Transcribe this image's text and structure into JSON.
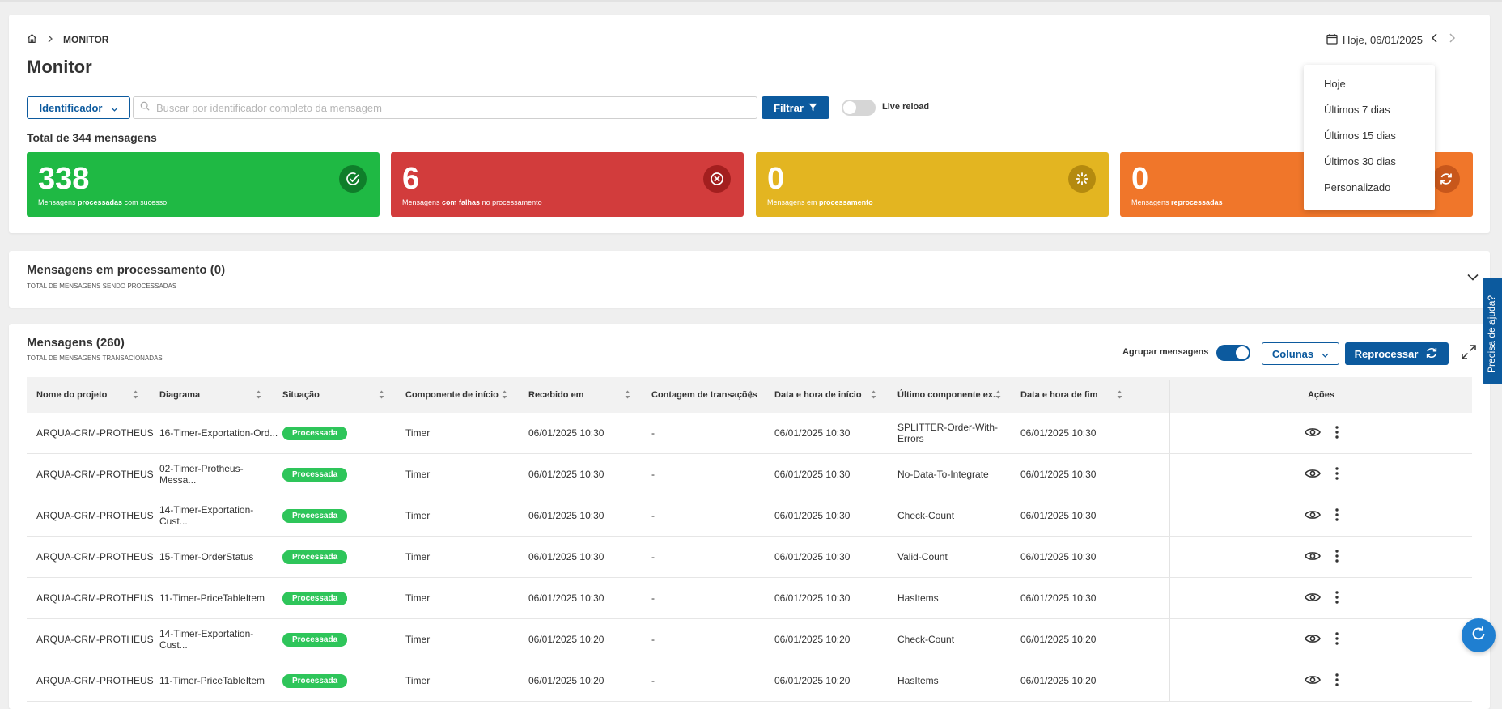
{
  "breadcrumb": {
    "current": "MONITOR"
  },
  "page_title": "Monitor",
  "search": {
    "select_label": "Identificador",
    "placeholder": "Buscar por identificador completo da mensagem",
    "value": ""
  },
  "filter_button": "Filtrar",
  "live_reload": {
    "label": "Live reload",
    "enabled": false
  },
  "date_nav": {
    "label": "Hoje, 06/01/2025"
  },
  "date_dropdown": [
    "Hoje",
    "Últimos 7 dias",
    "Últimos 15 dias",
    "Últimos 30 dias",
    "Personalizado"
  ],
  "total_label": "Total de 344 mensagens",
  "stats": [
    {
      "value": "338",
      "pre": "Mensagens ",
      "bold": "processadas",
      "post": " com sucesso",
      "color": "#1fb944",
      "icon": "check-circle-icon"
    },
    {
      "value": "6",
      "pre": "Mensagens ",
      "bold": "com falhas",
      "post": " no processamento",
      "color": "#d23c3c",
      "icon": "x-circle-icon"
    },
    {
      "value": "0",
      "pre": "Mensagens em ",
      "bold": "processamento",
      "post": "",
      "color": "#e3b521",
      "icon": "spinner-icon"
    },
    {
      "value": "0",
      "pre": "Mensagens ",
      "bold": "reprocessadas",
      "post": "",
      "color": "#f0762a",
      "icon": "refresh-icon"
    }
  ],
  "processing_section": {
    "title": "Mensagens em processamento (0)",
    "subtitle": "TOTAL DE MENSAGENS SENDO PROCESSADAS"
  },
  "messages_section": {
    "title": "Mensagens (260)",
    "subtitle": "TOTAL DE MENSAGENS TRANSACIONADAS",
    "group_label": "Agrupar mensagens",
    "group_enabled": true,
    "columns_button": "Colunas",
    "reprocess_button": "Reprocessar"
  },
  "table": {
    "headers": [
      "Nome do projeto",
      "Diagrama",
      "Situação",
      "Componente de início",
      "Recebido em",
      "Contagem de transações",
      "Data e hora de início",
      "Último componente ex...",
      "Data e hora de fim",
      "Ações"
    ],
    "rows": [
      [
        "ARQUA-CRM-PROTHEUS",
        "16-Timer-Exportation-Ord...",
        "Processada",
        "Timer",
        "06/01/2025 10:30",
        "-",
        "06/01/2025 10:30",
        "SPLITTER-Order-With-Errors",
        "06/01/2025 10:30"
      ],
      [
        "ARQUA-CRM-PROTHEUS",
        "02-Timer-Protheus-Messa...",
        "Processada",
        "Timer",
        "06/01/2025 10:30",
        "-",
        "06/01/2025 10:30",
        "No-Data-To-Integrate",
        "06/01/2025 10:30"
      ],
      [
        "ARQUA-CRM-PROTHEUS",
        "14-Timer-Exportation-Cust...",
        "Processada",
        "Timer",
        "06/01/2025 10:30",
        "-",
        "06/01/2025 10:30",
        "Check-Count",
        "06/01/2025 10:30"
      ],
      [
        "ARQUA-CRM-PROTHEUS",
        "15-Timer-OrderStatus",
        "Processada",
        "Timer",
        "06/01/2025 10:30",
        "-",
        "06/01/2025 10:30",
        "Valid-Count",
        "06/01/2025 10:30"
      ],
      [
        "ARQUA-CRM-PROTHEUS",
        "11-Timer-PriceTableItem",
        "Processada",
        "Timer",
        "06/01/2025 10:30",
        "-",
        "06/01/2025 10:30",
        "HasItems",
        "06/01/2025 10:30"
      ],
      [
        "ARQUA-CRM-PROTHEUS",
        "14-Timer-Exportation-Cust...",
        "Processada",
        "Timer",
        "06/01/2025 10:20",
        "-",
        "06/01/2025 10:20",
        "Check-Count",
        "06/01/2025 10:20"
      ],
      [
        "ARQUA-CRM-PROTHEUS",
        "11-Timer-PriceTableItem",
        "Processada",
        "Timer",
        "06/01/2025 10:20",
        "-",
        "06/01/2025 10:20",
        "HasItems",
        "06/01/2025 10:20"
      ]
    ]
  },
  "help_tab": "Precisa de ajuda?",
  "colors": {
    "primary": "#0c5a9e",
    "success": "#1fb944",
    "danger": "#d23c3c",
    "warning": "#e3b521",
    "orange": "#f0762a",
    "badge": "#2ec55a"
  }
}
